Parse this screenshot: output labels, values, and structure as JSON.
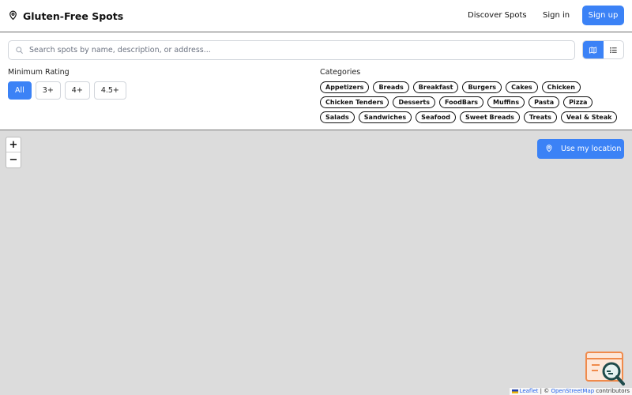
{
  "header": {
    "title": "Gluten-Free Spots",
    "nav": {
      "discover": "Discover Spots",
      "signin": "Sign in",
      "signup": "Sign up"
    }
  },
  "search": {
    "placeholder": "Search spots by name, description, or address...",
    "value": ""
  },
  "view_toggle": {
    "active": "map"
  },
  "filters": {
    "rating_label": "Minimum Rating",
    "ratings": [
      "All",
      "3+ ",
      "4+ ",
      "4.5+ "
    ],
    "categories_label": "Categories",
    "categories": [
      "Appetizers",
      "Breads",
      "Breakfast",
      "Burgers",
      "Cakes",
      "Chicken",
      "Chicken Tenders",
      "Desserts",
      "FoodBars",
      "Muffins",
      "Pasta",
      "Pizza",
      "Salads",
      "Sandwiches",
      "Seafood",
      "Sweet Breads",
      "Treats",
      "Veal & Steak"
    ]
  },
  "map": {
    "zoom_in": "+",
    "zoom_out": "−",
    "locate_label": "Use my location",
    "attribution": {
      "leaflet": "Leaflet",
      "separator": " | © ",
      "osm": "OpenStreetMap",
      "suffix": " contributors"
    }
  },
  "colors": {
    "accent": "#3b82f6",
    "map_bg": "#dcdcdc"
  }
}
